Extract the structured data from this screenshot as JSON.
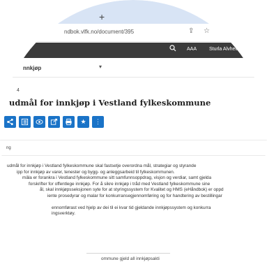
{
  "browser": {
    "new_tab_icon": "plus-icon",
    "url": "ndbok.vlfk.no/document/395",
    "icons": [
      "share-icon",
      "star-icon"
    ]
  },
  "header": {
    "search_icon": "search-icon",
    "text_size": "AAA",
    "user": "Sturla Alvheim"
  },
  "subnav": {
    "label": "nnkjøp",
    "caret": "▾"
  },
  "breadcrumb": "4",
  "page": {
    "title": "udmål for innkjøp i Vestland fylkeskommune"
  },
  "toolbar": {
    "buttons": [
      "share-icon",
      "list-icon",
      "view-icon",
      "export-icon",
      "print-icon",
      "star-icon",
      "more-icon"
    ]
  },
  "section": {
    "label": "ng"
  },
  "content": {
    "p1": [
      "udmål for innkjøp i Vestland fylkeskommune skal fastsetje overordna mål, strategiar og styrande",
      "ipp for innkjøp av varer, tenester og bygg- og anleggsarbeid til fylkeskommunen.",
      "mâla er forankra i Vestland fylkeskommune sitt samfunnsoppdrag, visjon og verdiar, samt gjelda",
      "forskrifter for offentlege innkjøp. For å sikre innkjøp i tråd med Vestland fylkeskommune sine",
      "ål, skal innkjøpsseksjonen syte for at styringssystem for Kvalitet og HMS (eHåndbok) er oppd",
      "iente prosedyrar og malar for konkurransegjennomføring og for handtering av bestillingar"
    ],
    "p2": [
      "ennomførast ved hjelp av dei til ei kvar tid gjeldande innkjøpssystem og konkurra",
      "ingsverktøy."
    ]
  },
  "footer": {
    "text": "ommune gjeld all innkjøpsakti"
  }
}
